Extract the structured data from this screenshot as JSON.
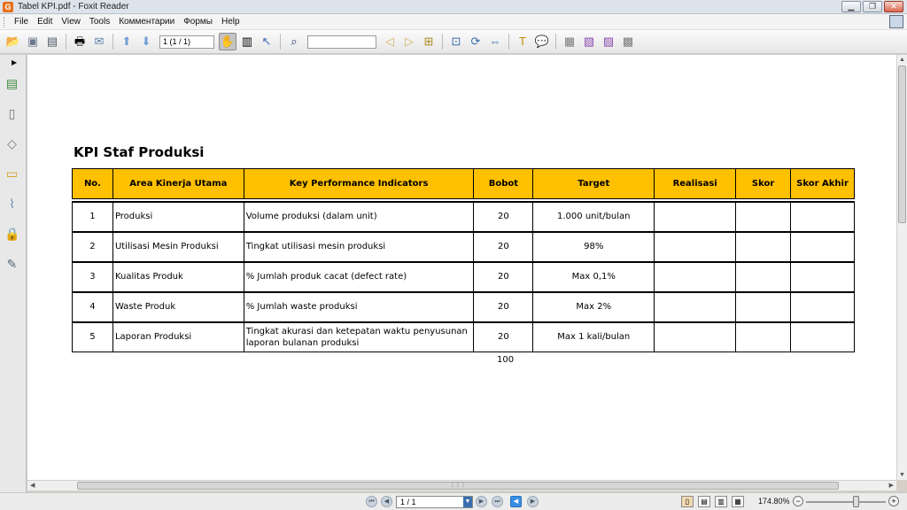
{
  "window": {
    "title": "Tabel KPI.pdf - Foxit Reader",
    "app_icon": "G"
  },
  "menu": [
    "File",
    "Edit",
    "View",
    "Tools",
    "Комментарии",
    "Формы",
    "Help"
  ],
  "toolbar": {
    "page_indicator": "1 (1 / 1)",
    "search_placeholder": ""
  },
  "document": {
    "title": "KPI Staf Produksi",
    "headers": [
      "No.",
      "Area Kinerja Utama",
      "Key Performance Indicators",
      "Bobot",
      "Target",
      "Realisasi",
      "Skor",
      "Skor Akhir"
    ],
    "rows": [
      {
        "no": "1",
        "area": "Produksi",
        "kpi": "Volume produksi (dalam unit)",
        "bobot": "20",
        "target": "1.000 unit/bulan",
        "realisasi": "",
        "skor": "",
        "skor_akhir": ""
      },
      {
        "no": "2",
        "area": "Utilisasi Mesin Produksi",
        "kpi": "Tingkat utilisasi mesin produksi",
        "bobot": "20",
        "target": "98%",
        "realisasi": "",
        "skor": "",
        "skor_akhir": ""
      },
      {
        "no": "3",
        "area": "Kualitas Produk",
        "kpi": "% Jumlah produk cacat (defect rate)",
        "bobot": "20",
        "target": "Max 0,1%",
        "realisasi": "",
        "skor": "",
        "skor_akhir": ""
      },
      {
        "no": "4",
        "area": "Waste Produk",
        "kpi": "% Jumlah waste produksi",
        "bobot": "20",
        "target": "Max 2%",
        "realisasi": "",
        "skor": "",
        "skor_akhir": ""
      },
      {
        "no": "5",
        "area": "Laporan Produksi",
        "kpi": "Tingkat akurasi dan ketepatan waktu penyusunan laporan bulanan produksi",
        "bobot": "20",
        "target": "Max 1 kali/bulan",
        "realisasi": "",
        "skor": "",
        "skor_akhir": ""
      }
    ],
    "total_bobot": "100"
  },
  "statusbar": {
    "page": "1 / 1",
    "zoom": "174.80%",
    "zoom_level_fraction": 0.6
  },
  "colors": {
    "header_fill": "#ffc000",
    "accent_blue": "#3a8ee6"
  }
}
